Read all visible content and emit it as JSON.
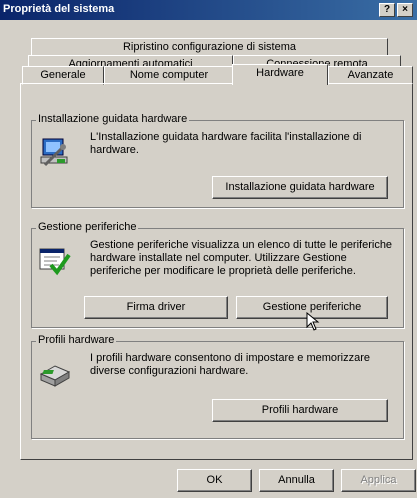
{
  "window": {
    "title": "Proprietà del sistema",
    "help_label": "?",
    "close_label": "×"
  },
  "tabs": {
    "row1": [
      "Ripristino configurazione di sistema"
    ],
    "row2": [
      "Aggiornamenti automatici",
      "Connessione remota"
    ],
    "row3": [
      "Generale",
      "Nome computer",
      "Hardware",
      "Avanzate"
    ],
    "active": "Hardware"
  },
  "wizard": {
    "legend": "Installazione guidata hardware",
    "description": "L'Installazione guidata hardware facilita l'installazione di hardware.",
    "button": "Installazione guidata hardware"
  },
  "devices": {
    "legend": "Gestione periferiche",
    "description": "Gestione periferiche visualizza un elenco di tutte le periferiche hardware installate nel computer. Utilizzare Gestione periferiche per modificare le proprietà delle periferiche.",
    "driver_button": "Firma driver",
    "manager_button": "Gestione periferiche"
  },
  "profiles": {
    "legend": "Profili hardware",
    "description": "I profili hardware consentono di impostare e memorizzare diverse configurazioni hardware.",
    "button": "Profili hardware"
  },
  "footer": {
    "ok": "OK",
    "cancel": "Annulla",
    "apply": "Applica"
  }
}
